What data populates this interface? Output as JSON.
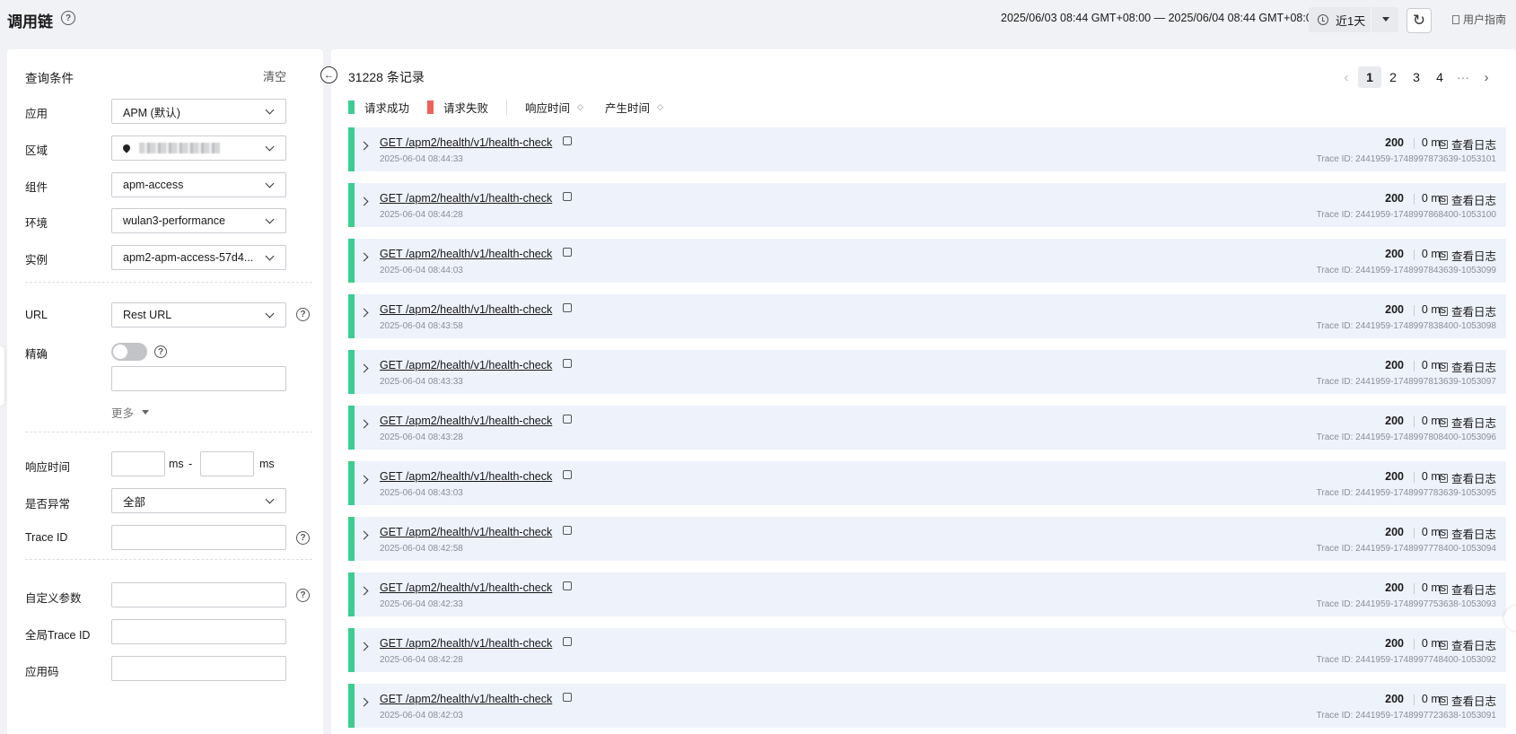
{
  "header": {
    "title": "调用链",
    "time_range": "2025/06/03 08:44 GMT+08:00 — 2025/06/04 08:44 GMT+08:00",
    "time_preset": "近1天",
    "guide": "用户指南"
  },
  "filters": {
    "title": "查询条件",
    "clear": "清空",
    "app_label": "应用",
    "app_value": "APM (默认)",
    "region_label": "区域",
    "component_label": "组件",
    "component_value": "apm-access",
    "env_label": "环境",
    "env_value": "wulan3-performance",
    "instance_label": "实例",
    "instance_value": "apm2-apm-access-57d4...",
    "url_label": "URL",
    "url_value": "Rest URL",
    "exact_label": "精确",
    "more": "更多",
    "resp_label": "响应时间",
    "ms1": "ms",
    "dash": "-",
    "ms2": "ms",
    "abnormal_label": "是否异常",
    "abnormal_value": "全部",
    "traceid_label": "Trace ID",
    "custom_label": "自定义参数",
    "global_label": "全局Trace ID",
    "appcode_label": "应用码"
  },
  "results": {
    "count": "31228 条记录",
    "pages": [
      "1",
      "2",
      "3",
      "4",
      "···"
    ],
    "legend_success": "请求成功",
    "legend_fail": "请求失败",
    "sort_resp": "响应时间",
    "sort_time": "产生时间",
    "success_color": "#3dcc91",
    "fail_color": "#f0605a",
    "rows": [
      {
        "url": "GET /apm2/health/v1/health-check",
        "time": "2025-06-04 08:44:33",
        "status": "200",
        "duration": "0 ms",
        "log": "查看日志",
        "trace": "Trace ID:  2441959-1748997873639-1053101"
      },
      {
        "url": "GET /apm2/health/v1/health-check",
        "time": "2025-06-04 08:44:28",
        "status": "200",
        "duration": "0 ms",
        "log": "查看日志",
        "trace": "Trace ID:  2441959-1748997868400-1053100"
      },
      {
        "url": "GET /apm2/health/v1/health-check",
        "time": "2025-06-04 08:44:03",
        "status": "200",
        "duration": "0 ms",
        "log": "查看日志",
        "trace": "Trace ID:  2441959-1748997843639-1053099"
      },
      {
        "url": "GET /apm2/health/v1/health-check",
        "time": "2025-06-04 08:43:58",
        "status": "200",
        "duration": "0 ms",
        "log": "查看日志",
        "trace": "Trace ID:  2441959-1748997838400-1053098"
      },
      {
        "url": "GET /apm2/health/v1/health-check",
        "time": "2025-06-04 08:43:33",
        "status": "200",
        "duration": "0 ms",
        "log": "查看日志",
        "trace": "Trace ID:  2441959-1748997813639-1053097"
      },
      {
        "url": "GET /apm2/health/v1/health-check",
        "time": "2025-06-04 08:43:28",
        "status": "200",
        "duration": "0 ms",
        "log": "查看日志",
        "trace": "Trace ID:  2441959-1748997808400-1053096"
      },
      {
        "url": "GET /apm2/health/v1/health-check",
        "time": "2025-06-04 08:43:03",
        "status": "200",
        "duration": "0 ms",
        "log": "查看日志",
        "trace": "Trace ID:  2441959-1748997783639-1053095"
      },
      {
        "url": "GET /apm2/health/v1/health-check",
        "time": "2025-06-04 08:42:58",
        "status": "200",
        "duration": "0 ms",
        "log": "查看日志",
        "trace": "Trace ID:  2441959-1748997778400-1053094"
      },
      {
        "url": "GET /apm2/health/v1/health-check",
        "time": "2025-06-04 08:42:33",
        "status": "200",
        "duration": "0 ms",
        "log": "查看日志",
        "trace": "Trace ID:  2441959-1748997753638-1053093"
      },
      {
        "url": "GET /apm2/health/v1/health-check",
        "time": "2025-06-04 08:42:28",
        "status": "200",
        "duration": "0 ms",
        "log": "查看日志",
        "trace": "Trace ID:  2441959-1748997748400-1053092"
      },
      {
        "url": "GET /apm2/health/v1/health-check",
        "time": "2025-06-04 08:42:03",
        "status": "200",
        "duration": "0 ms",
        "log": "查看日志",
        "trace": "Trace ID:  2441959-1748997723638-1053091"
      }
    ]
  }
}
